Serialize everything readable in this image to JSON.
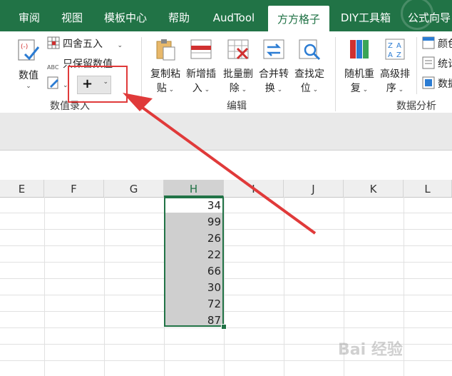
{
  "tabs": [
    "审阅",
    "视图",
    "模板中心",
    "帮助",
    "AudTool",
    "方方格子",
    "DIY工具箱",
    "公式向导"
  ],
  "active_tab": "方方格子",
  "ribbon": {
    "numeric_group": {
      "shuzhi_label": "数值",
      "round_label": "四舍五入",
      "keep_value_label": "只保留数值",
      "plus_symbol": "+",
      "group_label": "数值录入"
    },
    "edit_group": {
      "copy_paste": [
        "复制粘",
        "贴"
      ],
      "insert_new": [
        "新增插",
        "入"
      ],
      "batch_delete": [
        "批量删",
        "除"
      ],
      "merge_convert": [
        "合并转",
        "换"
      ],
      "find_locate": [
        "查找定",
        "位"
      ],
      "group_label": "编辑"
    },
    "analysis_group": {
      "random_repeat": [
        "随机重",
        "复"
      ],
      "advanced_sort": [
        "高级排",
        "序"
      ],
      "color_label": "颜色",
      "stat_label": "统计",
      "data_label": "数据",
      "group_label": "数据分析"
    }
  },
  "columns": [
    "E",
    "F",
    "G",
    "H",
    "I",
    "J",
    "K",
    "L"
  ],
  "selected_column": "H",
  "cells_H": [
    "34",
    "99",
    "26",
    "22",
    "66",
    "30",
    "72",
    "87"
  ],
  "watermark": "Bai 经验",
  "colors": {
    "accent": "#217346",
    "highlight": "#e03a3a"
  }
}
